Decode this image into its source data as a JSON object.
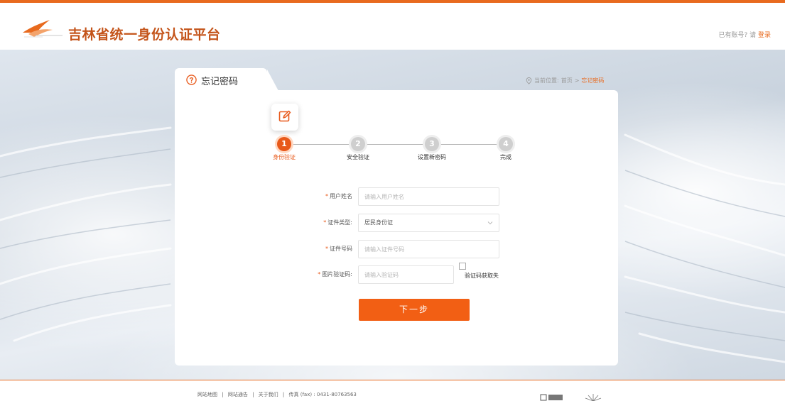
{
  "header": {
    "site_title": "吉林省统一身份认证平台",
    "logo_icon": "crane-logo-icon",
    "has_account_text": "已有账号?",
    "please_text": "请",
    "login_label": "登录"
  },
  "page": {
    "tab_title": "忘记密码",
    "help_icon": "question-circle-icon",
    "breadcrumb": {
      "prefix": "当前位置:",
      "home": "首页",
      "separator": ">",
      "current": "忘记密码"
    }
  },
  "steps": [
    {
      "number": "1",
      "label": "身份验证",
      "active": true
    },
    {
      "number": "2",
      "label": "安全验证",
      "active": false
    },
    {
      "number": "3",
      "label": "设置新密码",
      "active": false
    },
    {
      "number": "4",
      "label": "完成",
      "active": false
    }
  ],
  "form": {
    "username": {
      "label": "用户姓名",
      "placeholder": "请输入用户姓名"
    },
    "id_type": {
      "label": "证件类型:",
      "value": "居民身份证"
    },
    "id_number": {
      "label": "证件号码",
      "placeholder": "请输入证件号码"
    },
    "captcha": {
      "label": "图片验证码:",
      "placeholder": "请输入验证码",
      "fail_text": "验证码获取失"
    }
  },
  "next_button": "下一步",
  "footer": {
    "links": [
      "网站地图",
      "网站通告",
      "关于我们"
    ],
    "separator": "|",
    "fax": "传真 (fax) : 0431-80763563"
  },
  "colors": {
    "accent": "#e8591a",
    "button": "#f25f14"
  }
}
